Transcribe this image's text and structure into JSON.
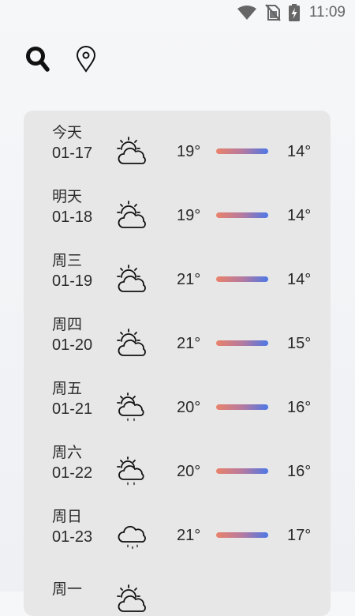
{
  "status_bar": {
    "time": "11:09",
    "icons": [
      "wifi-icon",
      "no-sim-icon",
      "battery-charging-icon"
    ]
  },
  "toolbar": {
    "icons": [
      "search-icon",
      "location-pin-icon"
    ]
  },
  "forecast": [
    {
      "day": "今天",
      "date": "01-17",
      "icon": "partly-cloudy-icon",
      "high": "19°",
      "low": "14°"
    },
    {
      "day": "明天",
      "date": "01-18",
      "icon": "partly-cloudy-icon",
      "high": "19°",
      "low": "14°"
    },
    {
      "day": "周三",
      "date": "01-19",
      "icon": "partly-cloudy-icon",
      "high": "21°",
      "low": "14°"
    },
    {
      "day": "周四",
      "date": "01-20",
      "icon": "partly-cloudy-icon",
      "high": "21°",
      "low": "15°"
    },
    {
      "day": "周五",
      "date": "01-21",
      "icon": "sun-rain-icon",
      "high": "20°",
      "low": "16°"
    },
    {
      "day": "周六",
      "date": "01-22",
      "icon": "sun-rain-icon",
      "high": "20°",
      "low": "16°"
    },
    {
      "day": "周日",
      "date": "01-23",
      "icon": "rain-cloud-icon",
      "high": "21°",
      "low": "17°"
    },
    {
      "day": "周一",
      "date": "",
      "icon": "partly-cloudy-icon",
      "high": "",
      "low": ""
    }
  ],
  "colors": {
    "temp_bar_warm": "#e9826a",
    "temp_bar_cool": "#4d77e6",
    "card_background": "#e7e7e7"
  }
}
